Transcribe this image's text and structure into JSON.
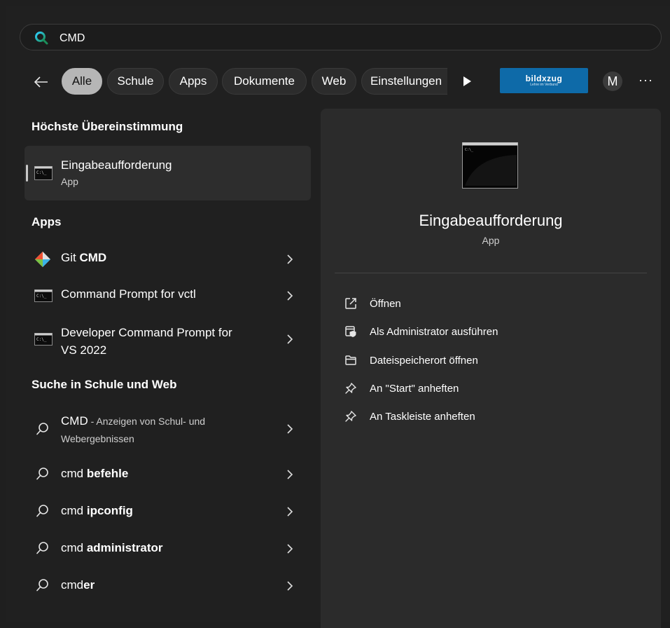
{
  "search": {
    "value": "CMD"
  },
  "filters": {
    "chips": [
      "Alle",
      "Schule",
      "Apps",
      "Dokumente",
      "Web",
      "Einstellungen"
    ],
    "logo_text": "bildxzug",
    "logo_subtext": "Lehre im Verbund",
    "avatar_initial": "M",
    "more_label": "···"
  },
  "best_match": {
    "header": "Höchste Übereinstimmung",
    "title": "Eingabeaufforderung",
    "type": "App"
  },
  "apps": {
    "header": "Apps",
    "items": [
      {
        "prefix": "Git ",
        "bold": "CMD"
      },
      {
        "label": "Command Prompt for vctl"
      },
      {
        "line1": "Developer Command Prompt for",
        "line2": "VS 2022"
      }
    ]
  },
  "web": {
    "header": "Suche in Schule und Web",
    "first": {
      "term": "CMD",
      "suffix": " - Anzeigen von Schul- und",
      "suffix2": "Webergebnissen"
    },
    "items": [
      {
        "prefix": "cmd ",
        "bold": "befehle",
        "suffix": ""
      },
      {
        "prefix": "cmd ",
        "bold": "ipconfig",
        "suffix": ""
      },
      {
        "prefix": "cmd ",
        "bold": "administrator",
        "suffix": ""
      },
      {
        "prefix": "cmd",
        "bold": "",
        "suffix": "er"
      }
    ]
  },
  "preview": {
    "title": "Eingabeaufforderung",
    "subtitle": "App",
    "actions": [
      {
        "icon": "open-external-icon",
        "label": "Öffnen"
      },
      {
        "icon": "shield-admin-icon",
        "label": "Als Administrator ausführen"
      },
      {
        "icon": "folder-icon",
        "label": "Dateispeicherort öffnen"
      },
      {
        "icon": "pin-icon",
        "label": "An \"Start\" anheften"
      },
      {
        "icon": "pin-icon",
        "label": "An Taskleiste anheften"
      }
    ]
  },
  "colors": {
    "accent": "#0e6aa8",
    "panel": "#2b2b2b",
    "background": "#202020"
  }
}
